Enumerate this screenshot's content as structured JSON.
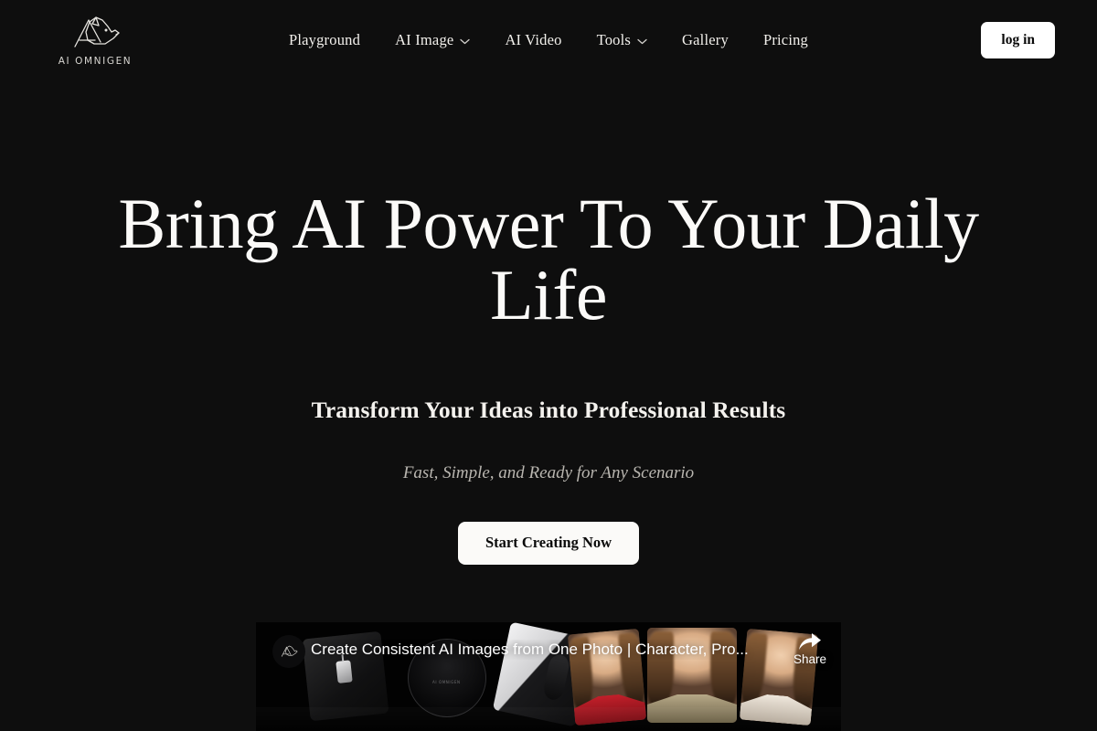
{
  "brand": {
    "name": "AI OMNIGEN",
    "logo_icon": "dog-head-logo-icon"
  },
  "nav": {
    "items": [
      {
        "label": "Playground",
        "has_dropdown": false
      },
      {
        "label": "AI Image",
        "has_dropdown": true,
        "icon": "chevron-down-icon"
      },
      {
        "label": "AI Video",
        "has_dropdown": false
      },
      {
        "label": "Tools",
        "has_dropdown": true,
        "icon": "chevron-down-icon"
      },
      {
        "label": "Gallery",
        "has_dropdown": false
      },
      {
        "label": "Pricing",
        "has_dropdown": false
      }
    ],
    "login_label": "log in"
  },
  "hero": {
    "title": "Bring AI Power To Your Daily Life",
    "subtitle": "Transform Your Ideas into Professional Results",
    "tagline": "Fast, Simple, and Ready for Any Scenario",
    "cta_label": "Start Creating Now"
  },
  "video": {
    "title": "Create Consistent AI Images from One Photo | Character, Pro...",
    "share_label": "Share",
    "share_icon": "share-arrow-icon",
    "channel_avatar_icon": "ai-omnigen-avatar-icon",
    "thumbnail_logo_text": "AI OMNIGEN"
  },
  "colors": {
    "background": "#0e0e0e",
    "text_primary": "#fbfaf8",
    "text_muted": "#b9b6b0",
    "button_bg": "#ffffff",
    "button_text": "#0a0a0a"
  }
}
